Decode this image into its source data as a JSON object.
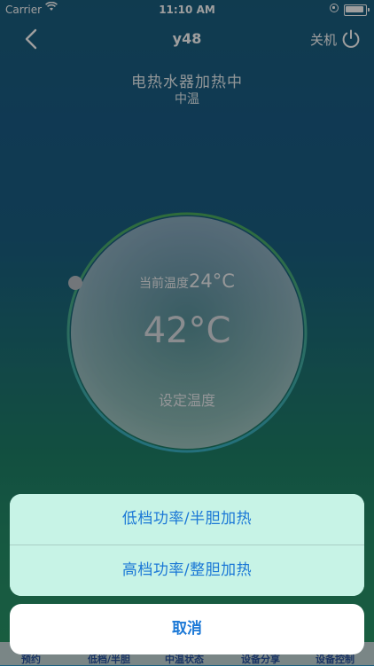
{
  "status_bar": {
    "carrier": "Carrier",
    "time": "11:10 AM"
  },
  "nav": {
    "title": "y48",
    "power_label": "关机"
  },
  "heater": {
    "status": "电热水器加热中",
    "mode": "中温"
  },
  "dial": {
    "current_label": "当前温度",
    "current_value": "24°C",
    "set_value": "42°C",
    "set_label": "设定温度"
  },
  "tab_bar": {
    "tabs": [
      "预约",
      "低档/半胆",
      "中温状态",
      "设备分享",
      "设备控制"
    ]
  },
  "action_sheet": {
    "options": [
      "低档功率/半胆加热",
      "高档功率/整胆加热"
    ],
    "cancel": "取消"
  },
  "colors": {
    "accent": "#1b78d6",
    "ring": "#4caf60"
  }
}
